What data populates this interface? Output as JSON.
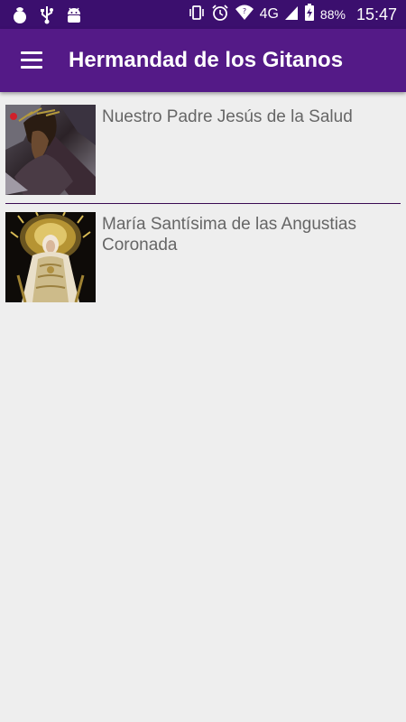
{
  "status_bar": {
    "network": "4G",
    "battery": "88%",
    "time": "15:47",
    "icons": [
      "notification-bag-icon",
      "usb-icon",
      "android-icon",
      "vibrate-icon",
      "alarm-icon",
      "wifi-icon",
      "signal-icon",
      "battery-charging-icon"
    ]
  },
  "app_bar": {
    "title": "Hermandad de los Gitanos",
    "menu_icon": "hamburger-menu-icon"
  },
  "list": {
    "items": [
      {
        "label": "Nuestro Padre Jesús de la Salud",
        "image": "jesus-salud-image"
      },
      {
        "label": "María Santísima de las Angustias Coronada",
        "image": "maria-angustias-image"
      }
    ]
  },
  "colors": {
    "status_bar": "#3b0f6e",
    "app_bar": "#541a87",
    "background": "#eeeeee",
    "divider": "#3a0b52",
    "label_text": "#666666"
  }
}
